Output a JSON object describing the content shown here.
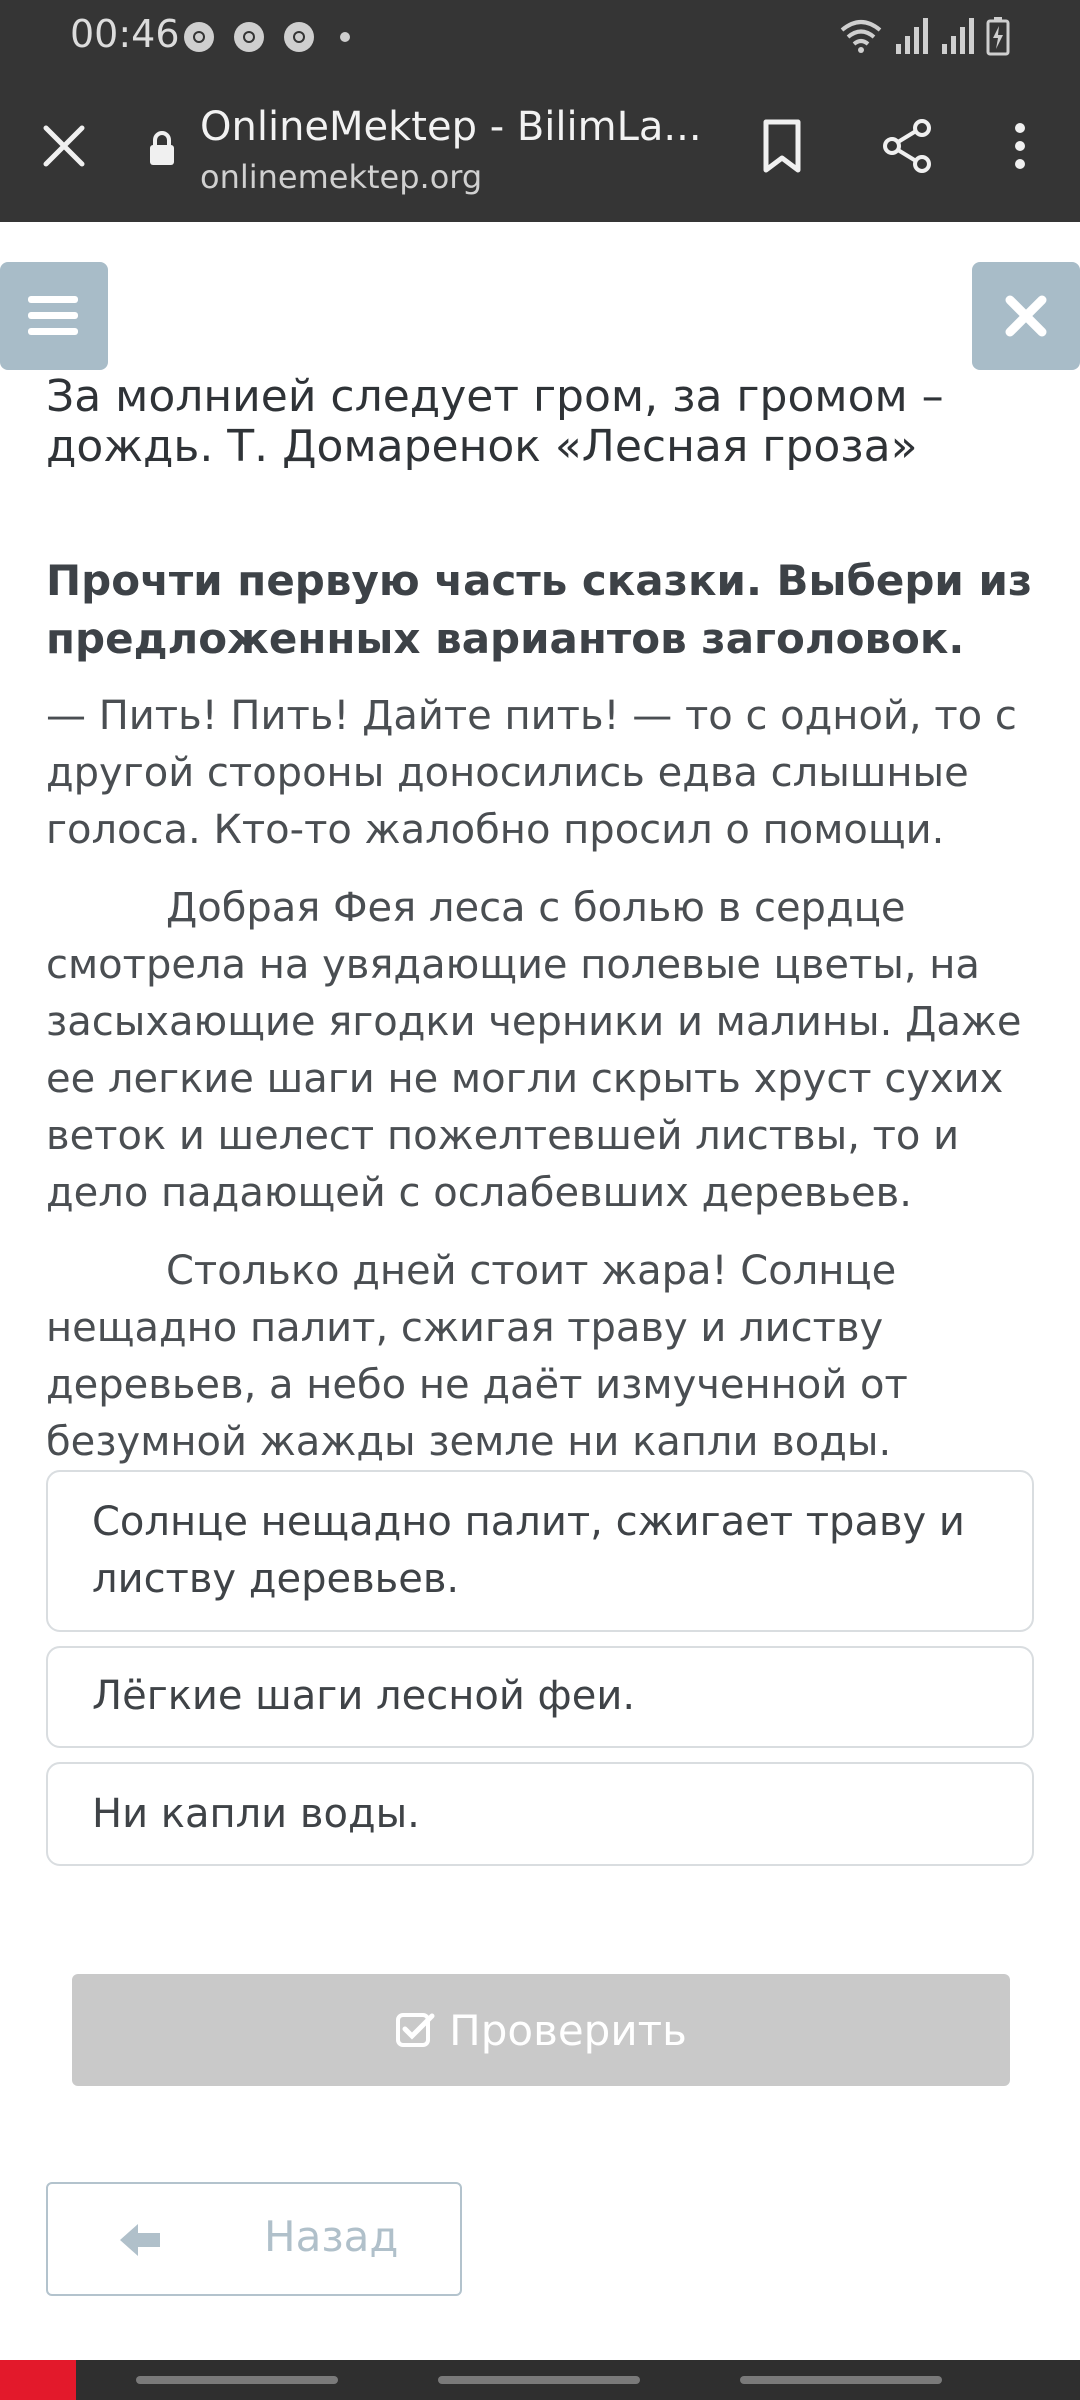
{
  "status_bar": {
    "time": "00:46",
    "icons": [
      "chrome-icon",
      "chrome-icon",
      "chrome-icon",
      "dot-icon",
      "wifi-icon",
      "signal-icon",
      "signal-icon",
      "battery-icon"
    ]
  },
  "browser": {
    "title": "OnlineMektep - BilimLa...",
    "url": "onlinemektep.org",
    "icons": [
      "close-icon",
      "lock-icon",
      "bookmark-icon",
      "share-icon",
      "more-icon"
    ]
  },
  "lesson": {
    "title": "За молнией следует гром, за громом – дождь. Т. Домаренок «Лесная гроза»",
    "task": "Прочти первую часть сказки. Выбери из предложенных вариантов заголовок.",
    "paragraphs": [
      "— Пить! Пить! Дайте пить! — то с одной, то с другой стороны доносились едва слышные голоса. Кто-то жалобно просил о помощи.",
      "Добрая Фея леса с болью в сердце смотрела на увядающие полевые цветы, на засыхающие ягодки черники и малины. Даже ее легкие шаги не могли скрыть хруст сухих веток и шелест пожелтевшей листвы, то и дело падающей с ослабевших деревьев.",
      "Столько дней стоит жара! Солнце нещадно палит, сжигая траву и листву деревьев, а небо не даёт измученной от безумной жажды земле ни капли воды."
    ],
    "options": [
      "Солнце нещадно палит, сжигает траву и листву деревьев.",
      "Лёгкие шаги лесной феи.",
      "Ни капли воды."
    ]
  },
  "buttons": {
    "check": "Проверить",
    "back": "Назад"
  },
  "colors": {
    "header_bg": "#353535",
    "side_button": "#a8bcc8",
    "check_disabled": "#c9c9c9",
    "back_border": "#b3c3cd"
  }
}
